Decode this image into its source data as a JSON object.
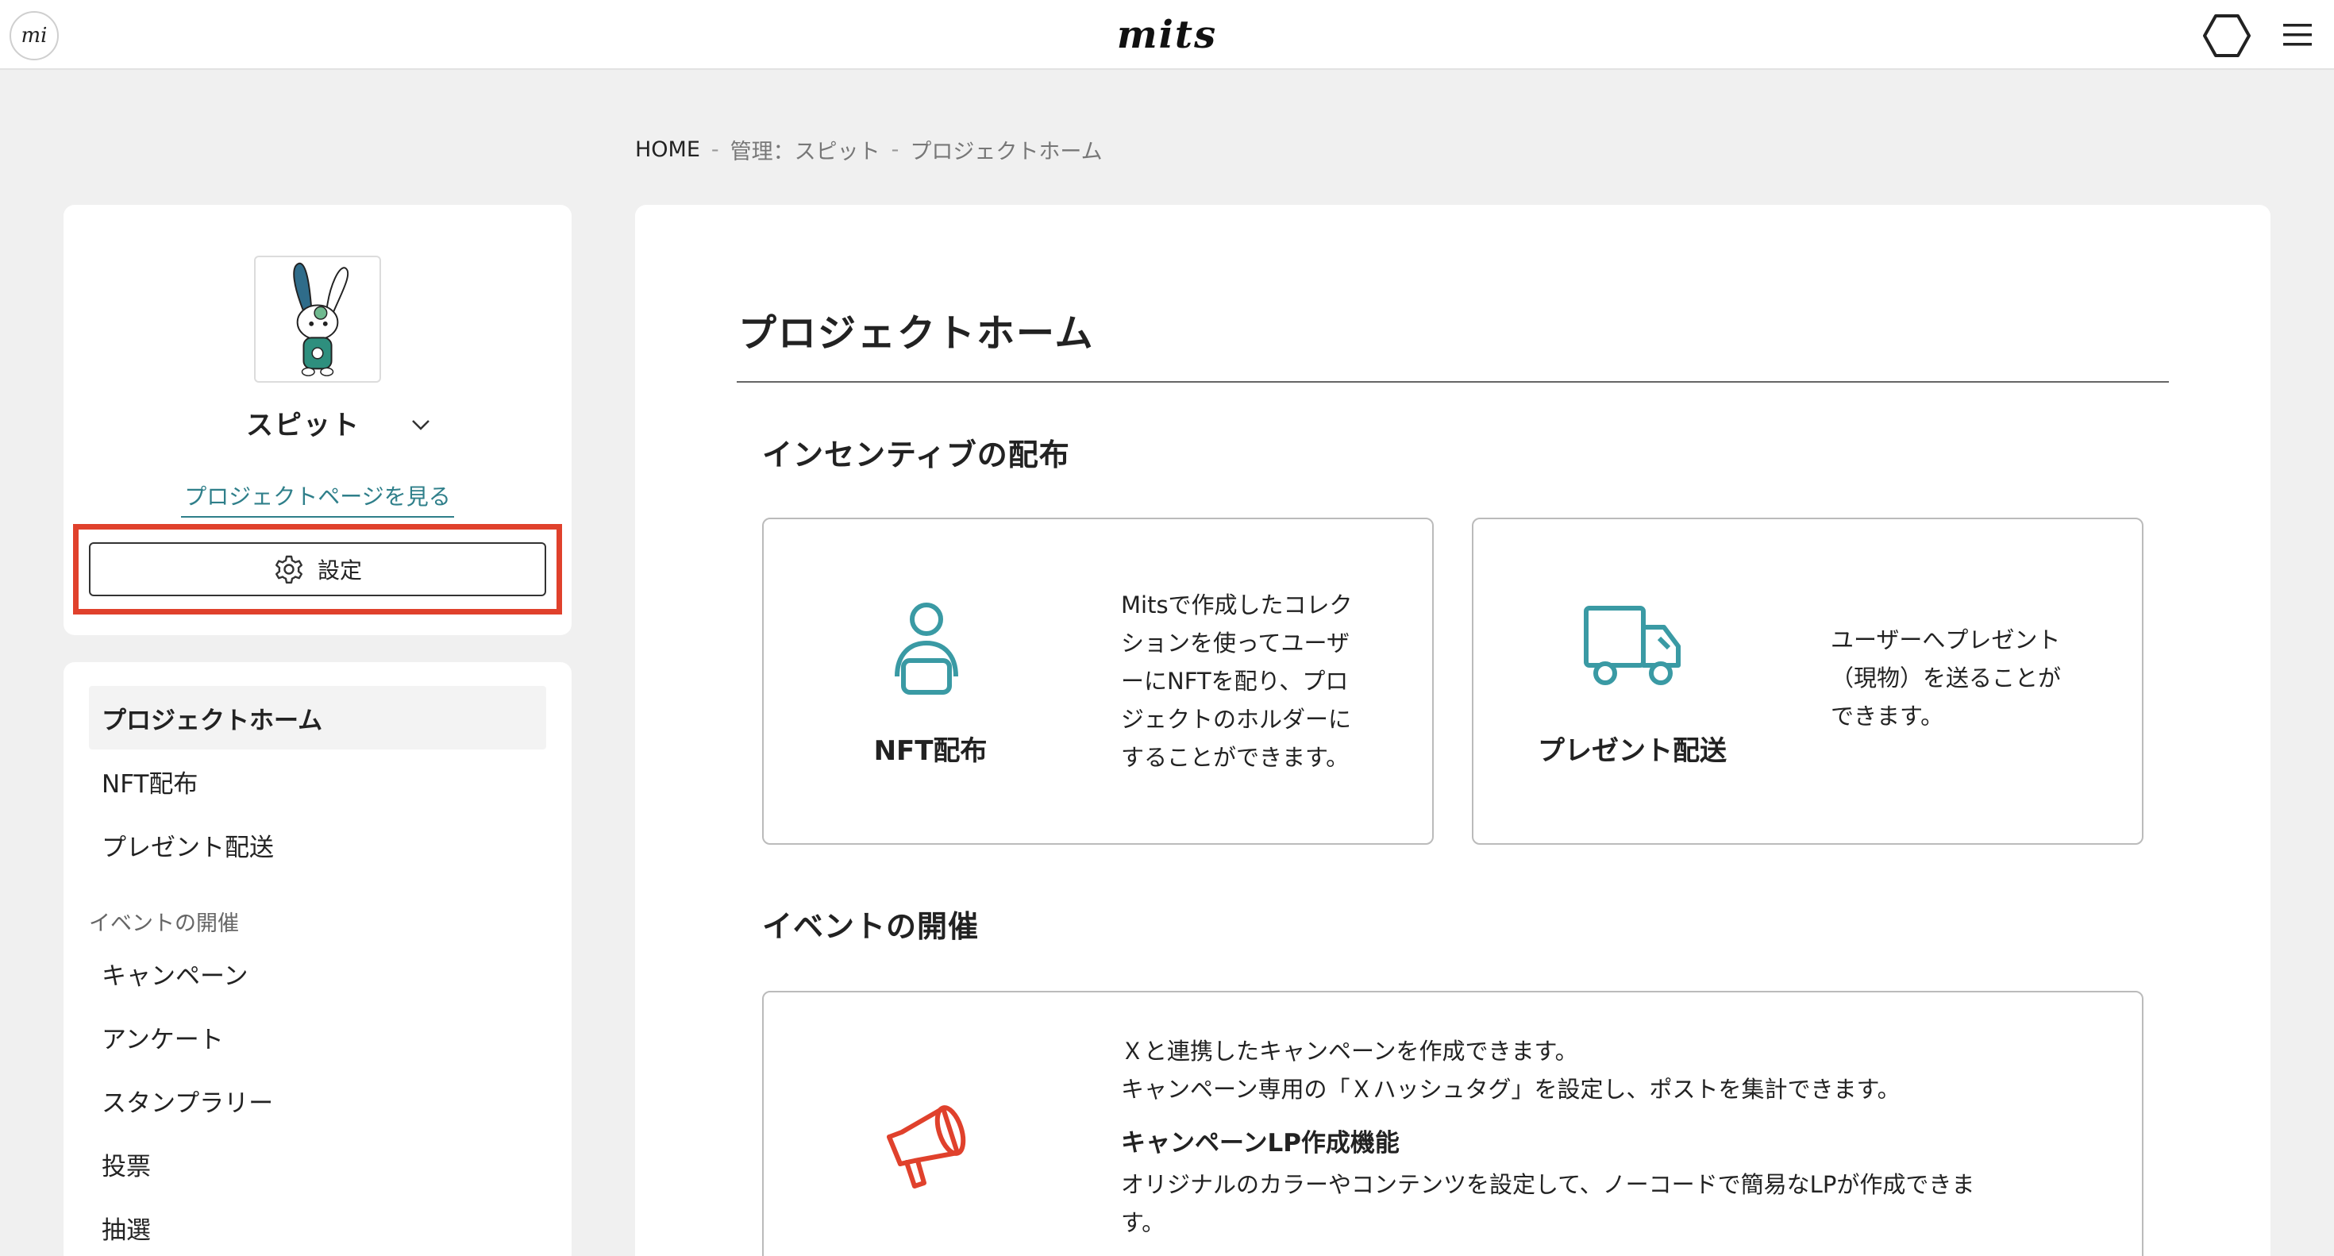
{
  "header": {
    "logo_text": "mi",
    "brand": "mits",
    "colors": {
      "accent": "#2f7f8a",
      "highlight": "#e0412c",
      "megaphone": "#e0412c"
    }
  },
  "breadcrumb": {
    "home": "HOME",
    "sep": "-",
    "admin": "管理：スピット",
    "current": "プロジェクトホーム"
  },
  "project": {
    "name": "スピット",
    "view_page_link": "プロジェクトページを見る",
    "settings_label": "設定"
  },
  "nav": {
    "items": [
      {
        "label": "プロジェクトホーム"
      },
      {
        "label": "NFT配布"
      },
      {
        "label": "プレゼント配送"
      }
    ],
    "section_events": "イベントの開催",
    "event_items": [
      {
        "label": "キャンペーン"
      },
      {
        "label": "アンケート"
      },
      {
        "label": "スタンプラリー"
      },
      {
        "label": "投票"
      },
      {
        "label": "抽選"
      }
    ]
  },
  "main": {
    "title": "プロジェクトホーム",
    "incentive_section": "インセンティブの配布",
    "nft_card": {
      "name": "NFT配布",
      "desc_lines": [
        "Mitsで作成したコレク",
        "ションを使ってユーザ",
        "ーにNFTを配り、プロ",
        "ジェクトのホルダーに",
        "することができます。"
      ]
    },
    "present_card": {
      "name": "プレゼント配送",
      "desc_lines": [
        "ユーザーへプレゼント",
        "（現物）を送ることが",
        "できます。"
      ]
    },
    "event_section": "イベントの開催",
    "campaign_card": {
      "line1": "Ｘと連携したキャンペーンを作成できます。",
      "line2": "キャンペーン専用の「Ｘハッシュタグ」を設定し、ポストを集計できます。",
      "lp_title": "キャンペーンLP作成機能",
      "lp_line1": "オリジナルのカラーやコンテンツを設定して、ノーコードで簡易なLPが作成できま",
      "lp_line2": "す。"
    }
  },
  "icons": {
    "logo": "mi-logo-icon",
    "hex": "hexagon-icon",
    "menu": "hamburger-menu-icon",
    "chevron": "chevron-down-icon",
    "gear": "gear-icon",
    "person": "person-icon",
    "truck": "truck-icon",
    "megaphone": "megaphone-icon"
  }
}
